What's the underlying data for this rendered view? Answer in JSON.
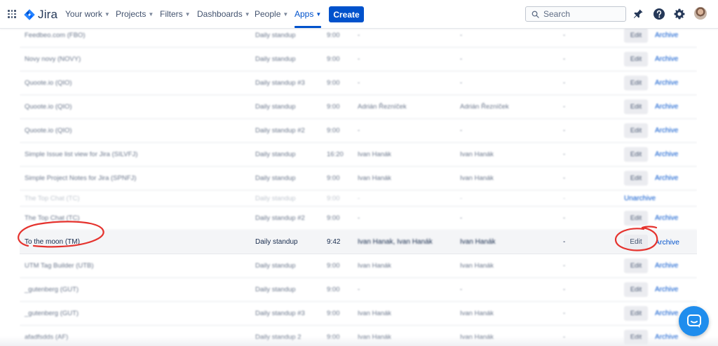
{
  "topbar": {
    "product": "Jira",
    "nav": [
      {
        "label": "Your work",
        "active": false
      },
      {
        "label": "Projects",
        "active": false
      },
      {
        "label": "Filters",
        "active": false
      },
      {
        "label": "Dashboards",
        "active": false
      },
      {
        "label": "People",
        "active": false
      },
      {
        "label": "Apps",
        "active": true
      }
    ],
    "create_label": "Create",
    "search_placeholder": "Search",
    "icons": [
      "app-switcher-icon",
      "jira-logo-icon",
      "chevron-down-icon",
      "search-icon",
      "notification-bell-icon",
      "help-icon",
      "settings-gear-icon",
      "avatar"
    ]
  },
  "table": {
    "edit_label": "Edit",
    "archive_label": "Archive",
    "unarchive_label": "Unarchive",
    "rows": [
      {
        "project": "Feedbeo.com (FBO)",
        "meeting": "Daily standup",
        "time": "9:00",
        "person1": "-",
        "person2": "-",
        "extra": "-",
        "state": "active"
      },
      {
        "project": "Novy novy (NOVY)",
        "meeting": "Daily standup",
        "time": "9:00",
        "person1": "-",
        "person2": "-",
        "extra": "-",
        "state": "active"
      },
      {
        "project": "Quoote.io (QIO)",
        "meeting": "Daily standup #3",
        "time": "9:00",
        "person1": "-",
        "person2": "-",
        "extra": "-",
        "state": "active"
      },
      {
        "project": "Quoote.io (QIO)",
        "meeting": "Daily standup",
        "time": "9:00",
        "person1": "Adrián Řezníček",
        "person2": "Adrián Řezníček",
        "extra": "-",
        "state": "active"
      },
      {
        "project": "Quoote.io (QIO)",
        "meeting": "Daily standup #2",
        "time": "9:00",
        "person1": "-",
        "person2": "-",
        "extra": "-",
        "state": "active"
      },
      {
        "project": "Simple Issue list view for Jira (SILVFJ)",
        "meeting": "Daily standup",
        "time": "16:20",
        "person1": "Ivan Hanák",
        "person2": "Ivan Hanák",
        "extra": "-",
        "state": "active"
      },
      {
        "project": "Simple Project Notes for Jira (SPNFJ)",
        "meeting": "Daily standup",
        "time": "9:00",
        "person1": "Ivan Hanák",
        "person2": "Ivan Hanák",
        "extra": "-",
        "state": "active"
      },
      {
        "project": "The Top Chat (TC)",
        "meeting": "Daily standup",
        "time": "9:00",
        "person1": "-",
        "person2": "-",
        "extra": "-",
        "state": "archived"
      },
      {
        "project": "The Top Chat (TC)",
        "meeting": "Daily standup #2",
        "time": "9:00",
        "person1": "-",
        "person2": "-",
        "extra": "-",
        "state": "active"
      },
      {
        "project": "To the moon (TM)",
        "meeting": "Daily standup",
        "time": "9:42",
        "person1": "Ivan Hanak, Ivan Hanák",
        "person2": "Ivan Hanák",
        "extra": "-",
        "state": "highlight"
      },
      {
        "project": "UTM Tag Builder (UTB)",
        "meeting": "Daily standup",
        "time": "9:00",
        "person1": "Ivan Hanák",
        "person2": "Ivan Hanák",
        "extra": "-",
        "state": "active"
      },
      {
        "project": "_gutenberg (GUT)",
        "meeting": "Daily standup",
        "time": "9:00",
        "person1": "-",
        "person2": "-",
        "extra": "-",
        "state": "active"
      },
      {
        "project": "_gutenberg (GUT)",
        "meeting": "Daily standup #3",
        "time": "9:00",
        "person1": "Ivan Hanák",
        "person2": "Ivan Hanák",
        "extra": "-",
        "state": "active"
      },
      {
        "project": "afadfsdds (AF)",
        "meeting": "Daily standup 2",
        "time": "9:00",
        "person1": "Ivan Hanák",
        "person2": "Ivan Hanák",
        "extra": "-",
        "state": "active"
      }
    ]
  },
  "colors": {
    "brand": "#0052cc",
    "annotation": "#e5322d",
    "chat": "#1f8ded"
  }
}
